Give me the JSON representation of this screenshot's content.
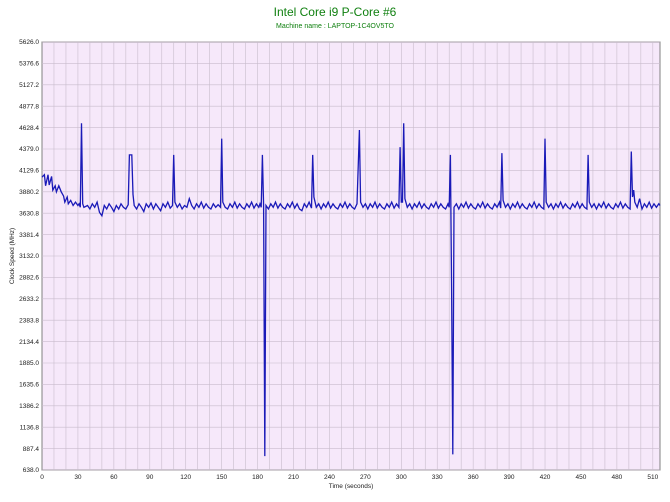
{
  "colors": {
    "background": "#ffffff",
    "plot_bg": "#f6e8fa",
    "grid": "#c8bccc",
    "series": "#1a1ab8",
    "title": "#108010",
    "axis": "#808080"
  },
  "chart_data": {
    "type": "line",
    "title": "Intel Core i9 P-Core #6",
    "subtitle": "Machine name : LAPTOP-1C4OV5TO",
    "xlabel": "Time (seconds)",
    "ylabel": "Clock Speed (MHz)",
    "xlim": [
      0,
      516
    ],
    "ylim": [
      638.0,
      5626.0
    ],
    "grid": true,
    "x_ticks": [
      0,
      30,
      60,
      90,
      120,
      150,
      180,
      210,
      240,
      270,
      300,
      330,
      360,
      390,
      420,
      450,
      480,
      510
    ],
    "y_ticks": [
      "638.0",
      "887.4",
      "1136.8",
      "1386.2",
      "1635.6",
      "1885.0",
      "2134.4",
      "2383.8",
      "2633.2",
      "2882.6",
      "3132.0",
      "3381.4",
      "3630.8",
      "3880.2",
      "4129.6",
      "4379.0",
      "4628.4",
      "4877.8",
      "5127.2",
      "5376.6",
      "5626.0"
    ],
    "series": [
      {
        "values": [
          [
            0,
            4050
          ],
          [
            2,
            4080
          ],
          [
            3,
            3950
          ],
          [
            5,
            4080
          ],
          [
            6,
            3960
          ],
          [
            8,
            4060
          ],
          [
            9,
            3900
          ],
          [
            11,
            3950
          ],
          [
            12,
            3880
          ],
          [
            14,
            3950
          ],
          [
            16,
            3880
          ],
          [
            18,
            3830
          ],
          [
            19,
            3760
          ],
          [
            21,
            3820
          ],
          [
            22,
            3740
          ],
          [
            24,
            3780
          ],
          [
            26,
            3720
          ],
          [
            28,
            3760
          ],
          [
            30,
            3720
          ],
          [
            31,
            3740
          ],
          [
            32,
            3700
          ],
          [
            33,
            4680
          ],
          [
            34,
            3740
          ],
          [
            35,
            3700
          ],
          [
            38,
            3720
          ],
          [
            40,
            3680
          ],
          [
            42,
            3740
          ],
          [
            44,
            3700
          ],
          [
            46,
            3760
          ],
          [
            48,
            3640
          ],
          [
            50,
            3600
          ],
          [
            52,
            3720
          ],
          [
            54,
            3680
          ],
          [
            56,
            3740
          ],
          [
            58,
            3700
          ],
          [
            60,
            3650
          ],
          [
            62,
            3720
          ],
          [
            64,
            3680
          ],
          [
            66,
            3740
          ],
          [
            68,
            3700
          ],
          [
            70,
            3680
          ],
          [
            72,
            3730
          ],
          [
            73,
            4310
          ],
          [
            75,
            4310
          ],
          [
            76,
            3850
          ],
          [
            77,
            3720
          ],
          [
            79,
            3680
          ],
          [
            81,
            3740
          ],
          [
            83,
            3700
          ],
          [
            85,
            3650
          ],
          [
            87,
            3740
          ],
          [
            89,
            3700
          ],
          [
            91,
            3750
          ],
          [
            93,
            3680
          ],
          [
            95,
            3740
          ],
          [
            97,
            3700
          ],
          [
            99,
            3660
          ],
          [
            101,
            3740
          ],
          [
            103,
            3700
          ],
          [
            105,
            3760
          ],
          [
            107,
            3690
          ],
          [
            109,
            3720
          ],
          [
            110,
            4310
          ],
          [
            111,
            3760
          ],
          [
            113,
            3700
          ],
          [
            115,
            3740
          ],
          [
            117,
            3680
          ],
          [
            119,
            3720
          ],
          [
            121,
            3700
          ],
          [
            123,
            3800
          ],
          [
            125,
            3720
          ],
          [
            127,
            3680
          ],
          [
            129,
            3740
          ],
          [
            131,
            3700
          ],
          [
            133,
            3760
          ],
          [
            135,
            3690
          ],
          [
            137,
            3740
          ],
          [
            139,
            3700
          ],
          [
            141,
            3680
          ],
          [
            143,
            3740
          ],
          [
            145,
            3700
          ],
          [
            147,
            3730
          ],
          [
            149,
            3700
          ],
          [
            150,
            4500
          ],
          [
            151,
            3760
          ],
          [
            153,
            3700
          ],
          [
            155,
            3680
          ],
          [
            157,
            3740
          ],
          [
            159,
            3700
          ],
          [
            161,
            3760
          ],
          [
            163,
            3690
          ],
          [
            165,
            3740
          ],
          [
            167,
            3700
          ],
          [
            169,
            3680
          ],
          [
            171,
            3740
          ],
          [
            173,
            3700
          ],
          [
            175,
            3760
          ],
          [
            177,
            3690
          ],
          [
            179,
            3740
          ],
          [
            181,
            3700
          ],
          [
            182,
            3740
          ],
          [
            183,
            3700
          ],
          [
            184,
            4310
          ],
          [
            185,
            3720
          ],
          [
            186,
            800
          ],
          [
            187,
            3720
          ],
          [
            189,
            3680
          ],
          [
            191,
            3740
          ],
          [
            193,
            3700
          ],
          [
            195,
            3760
          ],
          [
            197,
            3690
          ],
          [
            199,
            3740
          ],
          [
            201,
            3700
          ],
          [
            203,
            3680
          ],
          [
            205,
            3740
          ],
          [
            207,
            3700
          ],
          [
            209,
            3760
          ],
          [
            211,
            3690
          ],
          [
            213,
            3740
          ],
          [
            215,
            3680
          ],
          [
            217,
            3660
          ],
          [
            219,
            3740
          ],
          [
            221,
            3700
          ],
          [
            223,
            3760
          ],
          [
            225,
            3690
          ],
          [
            226,
            4310
          ],
          [
            227,
            3820
          ],
          [
            229,
            3700
          ],
          [
            231,
            3740
          ],
          [
            233,
            3680
          ],
          [
            235,
            3740
          ],
          [
            237,
            3700
          ],
          [
            239,
            3760
          ],
          [
            241,
            3690
          ],
          [
            243,
            3740
          ],
          [
            245,
            3700
          ],
          [
            247,
            3680
          ],
          [
            249,
            3740
          ],
          [
            251,
            3700
          ],
          [
            253,
            3760
          ],
          [
            255,
            3690
          ],
          [
            257,
            3740
          ],
          [
            259,
            3700
          ],
          [
            261,
            3680
          ],
          [
            263,
            3740
          ],
          [
            265,
            4600
          ],
          [
            266,
            3760
          ],
          [
            268,
            3700
          ],
          [
            270,
            3740
          ],
          [
            272,
            3680
          ],
          [
            274,
            3740
          ],
          [
            276,
            3700
          ],
          [
            278,
            3760
          ],
          [
            280,
            3690
          ],
          [
            282,
            3740
          ],
          [
            284,
            3700
          ],
          [
            286,
            3680
          ],
          [
            288,
            3740
          ],
          [
            290,
            3700
          ],
          [
            292,
            3760
          ],
          [
            294,
            3690
          ],
          [
            296,
            3740
          ],
          [
            298,
            3700
          ],
          [
            299,
            4400
          ],
          [
            300,
            3760
          ],
          [
            301,
            3760
          ],
          [
            302,
            4680
          ],
          [
            303,
            3800
          ],
          [
            305,
            3700
          ],
          [
            307,
            3740
          ],
          [
            309,
            3680
          ],
          [
            311,
            3740
          ],
          [
            313,
            3700
          ],
          [
            315,
            3760
          ],
          [
            317,
            3690
          ],
          [
            319,
            3740
          ],
          [
            321,
            3700
          ],
          [
            323,
            3680
          ],
          [
            325,
            3740
          ],
          [
            327,
            3700
          ],
          [
            329,
            3760
          ],
          [
            331,
            3690
          ],
          [
            333,
            3740
          ],
          [
            335,
            3700
          ],
          [
            337,
            3680
          ],
          [
            339,
            3740
          ],
          [
            340,
            3700
          ],
          [
            341,
            4310
          ],
          [
            342,
            2750
          ],
          [
            343,
            820
          ],
          [
            344,
            3700
          ],
          [
            346,
            3740
          ],
          [
            348,
            3680
          ],
          [
            350,
            3740
          ],
          [
            352,
            3700
          ],
          [
            354,
            3760
          ],
          [
            356,
            3690
          ],
          [
            358,
            3740
          ],
          [
            360,
            3700
          ],
          [
            362,
            3680
          ],
          [
            364,
            3740
          ],
          [
            366,
            3700
          ],
          [
            368,
            3760
          ],
          [
            370,
            3690
          ],
          [
            372,
            3740
          ],
          [
            374,
            3700
          ],
          [
            376,
            3680
          ],
          [
            378,
            3740
          ],
          [
            380,
            3700
          ],
          [
            382,
            3760
          ],
          [
            383,
            3690
          ],
          [
            384,
            4330
          ],
          [
            385,
            3780
          ],
          [
            387,
            3700
          ],
          [
            389,
            3740
          ],
          [
            391,
            3680
          ],
          [
            393,
            3740
          ],
          [
            395,
            3700
          ],
          [
            397,
            3760
          ],
          [
            399,
            3690
          ],
          [
            401,
            3740
          ],
          [
            403,
            3700
          ],
          [
            405,
            3680
          ],
          [
            407,
            3740
          ],
          [
            409,
            3700
          ],
          [
            411,
            3760
          ],
          [
            413,
            3690
          ],
          [
            415,
            3740
          ],
          [
            417,
            3700
          ],
          [
            419,
            3680
          ],
          [
            420,
            4500
          ],
          [
            421,
            3760
          ],
          [
            423,
            3700
          ],
          [
            425,
            3740
          ],
          [
            427,
            3680
          ],
          [
            429,
            3740
          ],
          [
            431,
            3700
          ],
          [
            433,
            3760
          ],
          [
            435,
            3690
          ],
          [
            437,
            3740
          ],
          [
            439,
            3700
          ],
          [
            441,
            3680
          ],
          [
            443,
            3740
          ],
          [
            445,
            3700
          ],
          [
            447,
            3760
          ],
          [
            449,
            3690
          ],
          [
            451,
            3740
          ],
          [
            453,
            3700
          ],
          [
            455,
            3680
          ],
          [
            456,
            4310
          ],
          [
            457,
            3760
          ],
          [
            459,
            3700
          ],
          [
            461,
            3740
          ],
          [
            463,
            3680
          ],
          [
            465,
            3740
          ],
          [
            467,
            3700
          ],
          [
            469,
            3760
          ],
          [
            471,
            3690
          ],
          [
            473,
            3740
          ],
          [
            475,
            3700
          ],
          [
            477,
            3680
          ],
          [
            479,
            3740
          ],
          [
            481,
            3700
          ],
          [
            483,
            3760
          ],
          [
            485,
            3690
          ],
          [
            487,
            3740
          ],
          [
            489,
            3700
          ],
          [
            491,
            3680
          ],
          [
            492,
            4350
          ],
          [
            493,
            3820
          ],
          [
            494,
            3900
          ],
          [
            495,
            3760
          ],
          [
            497,
            3700
          ],
          [
            499,
            3800
          ],
          [
            501,
            3680
          ],
          [
            503,
            3740
          ],
          [
            505,
            3700
          ],
          [
            507,
            3760
          ],
          [
            509,
            3690
          ],
          [
            511,
            3740
          ],
          [
            513,
            3700
          ],
          [
            515,
            3740
          ],
          [
            516,
            3720
          ]
        ]
      }
    ]
  }
}
